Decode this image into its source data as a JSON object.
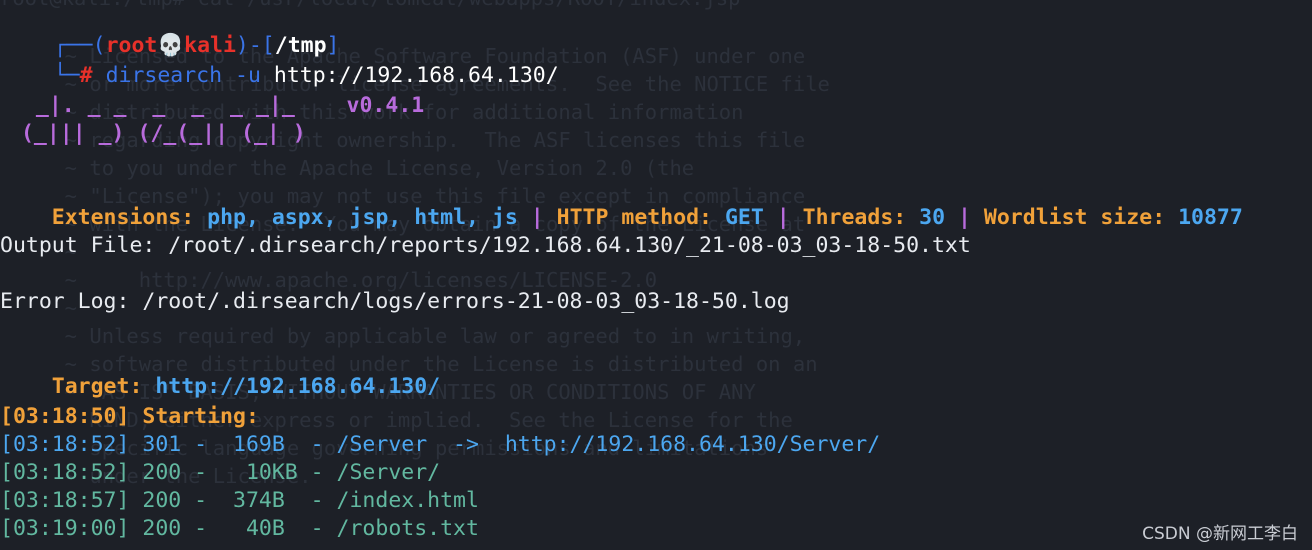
{
  "background_text": [
    "root@kali:/tmp# cat /usr/local/tomcat/webapps/ROOT/index.jsp",
    "  ~ Licensed to the Apache Software Foundation (ASF) under one",
    "  ~ or more contributor license agreements.  See the NOTICE file",
    "  ~ distributed with this work for additional information",
    "  ~ regarding copyright ownership.  The ASF licenses this file",
    "  ~ to you under the Apache License, Version 2.0 (the",
    "  ~ \"License\"); you may not use this file except in compliance",
    "  ~ with the License.  You may obtain a copy of the License at",
    "  ~",
    "  ~     http://www.apache.org/licenses/LICENSE-2.0",
    "  ~",
    "  ~ Unless required by applicable law or agreed to in writing,",
    "  ~ software distributed under the License is distributed on an",
    "  ~ \"AS IS\" BASIS, WITHOUT WARRANTIES OR CONDITIONS OF ANY",
    "  ~ KIND, either express or implied.  See the License for the",
    "  ~ specific language governing permissions and limitations",
    "  ~ under the License."
  ],
  "prompt": {
    "frame_top_left": "┌──(",
    "user": "root",
    "skull": "💀",
    "host": "kali",
    "frame_mid": ")-[",
    "dir": "/tmp",
    "frame_end": "]",
    "frame_bottom": "└─",
    "symbol": "#",
    "command": "dirsearch",
    "flag": "-u",
    "url": "http://192.168.64.130/"
  },
  "banner": {
    "line1": "  _|. _ _  _  _  _ _|_    ",
    "version": "v0.4.1",
    "line2": " (_||| _) (/_(_|| (_| )"
  },
  "config": {
    "extensions_label": "Extensions:",
    "extensions_value": "php, aspx, jsp, html, js",
    "sep": "|",
    "method_label": "HTTP method:",
    "method_value": "GET",
    "threads_label": "Threads:",
    "threads_value": "30",
    "wordlist_label": "Wordlist size:",
    "wordlist_value": "10877"
  },
  "output_file": "Output File: /root/.dirsearch/reports/192.168.64.130/_21-08-03_03-18-50.txt",
  "error_log": "Error Log: /root/.dirsearch/logs/errors-21-08-03_03-18-50.log",
  "target": {
    "label": "Target:",
    "value": "http://192.168.64.130/"
  },
  "starting": "[03:18:50] Starting:",
  "results": [
    {
      "text": "[03:18:52] 301 -  169B  - /Server  ->  http://192.168.64.130/Server/",
      "tone": "blue"
    },
    {
      "text": "[03:18:52] 200 -   10KB - /Server/",
      "tone": "green"
    },
    {
      "text": "[03:18:57] 200 -  374B  - /index.html",
      "tone": "green"
    },
    {
      "text": "[03:19:00] 200 -   40B  - /robots.txt",
      "tone": "green"
    }
  ],
  "watermark": "CSDN @新网工李白",
  "colors": {
    "background": "#1d2027",
    "prompt_blue": "#3a74e8",
    "root_red": "#e8312a",
    "banner_purple": "#b86bdc",
    "label_orange": "#f0a13a",
    "value_cyan": "#4ca7f0",
    "result_green": "#62b8a0"
  }
}
